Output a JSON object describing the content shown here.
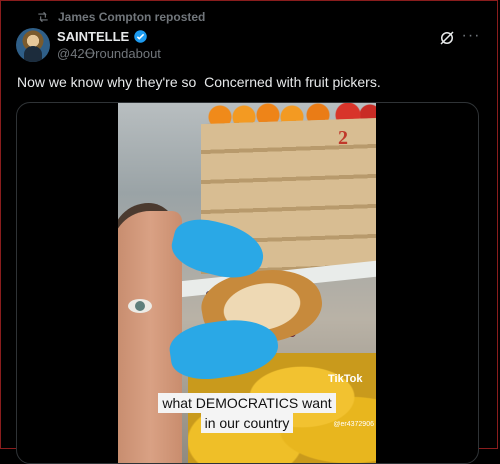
{
  "repost": {
    "text": "James Compton reposted",
    "icon": "repost-icon"
  },
  "post": {
    "author_name": "SAINTELLE",
    "author_handle": "@42Ꝋroundabout",
    "verified": true,
    "body": "Now we know why they're so  Concerned with fruit pickers."
  },
  "actions": {
    "grok_icon": "grok-icon",
    "more_label": "···"
  },
  "media": {
    "crate_label": "2",
    "caption_line1": "what DEMOCRATICS  want",
    "caption_line2": "in our country",
    "watermark": "TikTok",
    "watermark_user": "@er4372906"
  },
  "colors": {
    "background": "#000000",
    "verified": "#1d9bf0",
    "muted": "#71767b",
    "text": "#e7e9ea"
  }
}
